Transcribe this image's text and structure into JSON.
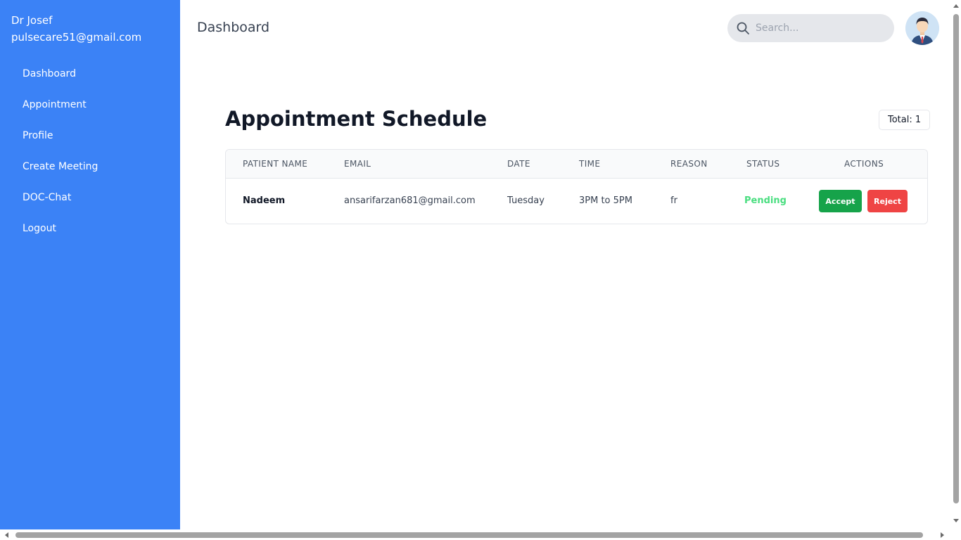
{
  "sidebar": {
    "user_name": "Dr Josef",
    "user_email": "pulsecare51@gmail.com",
    "items": [
      {
        "label": "Dashboard"
      },
      {
        "label": "Appointment"
      },
      {
        "label": "Profile"
      },
      {
        "label": "Create Meeting"
      },
      {
        "label": "DOC-Chat"
      },
      {
        "label": "Logout"
      }
    ]
  },
  "header": {
    "title": "Dashboard",
    "search_placeholder": "Search...",
    "search_value": ""
  },
  "main": {
    "title": "Appointment Schedule",
    "total_label": "Total: 1",
    "table": {
      "columns": [
        "PATIENT NAME",
        "EMAIL",
        "DATE",
        "TIME",
        "REASON",
        "STATUS",
        "ACTIONS"
      ],
      "rows": [
        {
          "patient_name": "Nadeem",
          "email": "ansarifarzan681@gmail.com",
          "date": "Tuesday",
          "time": "3PM to 5PM",
          "reason": "fr",
          "status": "Pending",
          "accept_label": "Accept",
          "reject_label": "Reject"
        }
      ]
    }
  },
  "colors": {
    "sidebar_bg": "#3b82f6",
    "status_pending": "#4ade80",
    "accept_button": "#16a34a",
    "reject_button": "#ef4444"
  },
  "icons": {
    "search": "search-icon",
    "avatar": "doctor-avatar"
  }
}
